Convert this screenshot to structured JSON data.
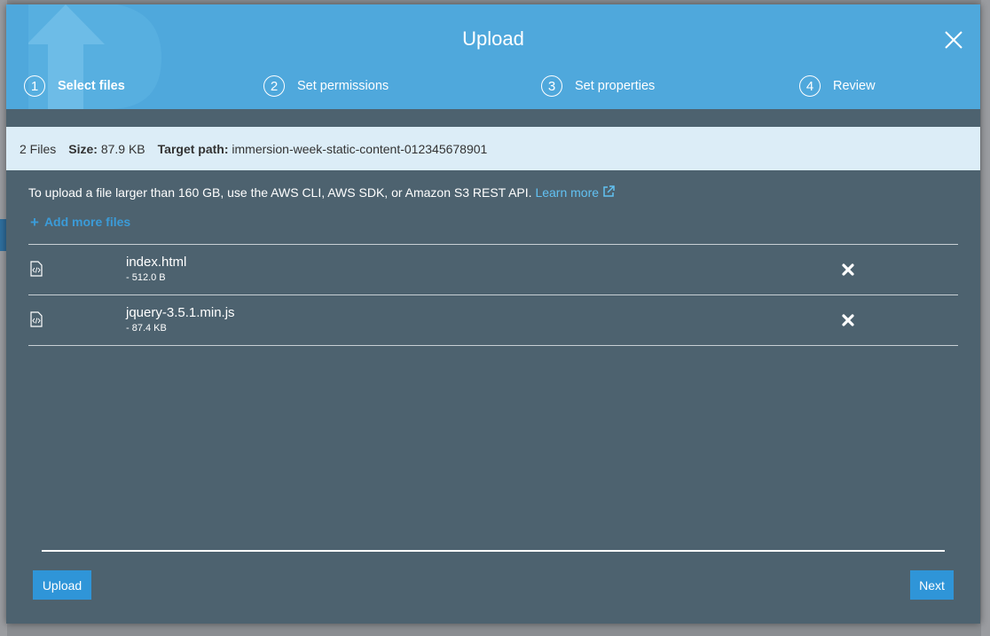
{
  "modal": {
    "title": "Upload"
  },
  "steps": [
    {
      "number": "1",
      "label": "Select files",
      "active": true
    },
    {
      "number": "2",
      "label": "Set permissions",
      "active": false
    },
    {
      "number": "3",
      "label": "Set properties",
      "active": false
    },
    {
      "number": "4",
      "label": "Review",
      "active": false
    }
  ],
  "summary": {
    "files_count": "2 Files",
    "size_label": "Size:",
    "size_value": "87.9 KB",
    "target_label": "Target path:",
    "target_value": "immersion-week-static-content-012345678901"
  },
  "info": {
    "text": "To upload a file larger than 160 GB, use the AWS CLI, AWS SDK, or Amazon S3 REST API.",
    "learn_more": "Learn more"
  },
  "add_more_label": "Add more files",
  "files": [
    {
      "name": "index.html",
      "size": "- 512.0 B"
    },
    {
      "name": "jquery-3.5.1.min.js",
      "size": "- 87.4 KB"
    }
  ],
  "footer": {
    "upload_label": "Upload",
    "next_label": "Next"
  },
  "colors": {
    "header": "#4fa8dc",
    "body": "#4d626f",
    "summary_bar": "#dcedf7",
    "button": "#2f95d8",
    "link": "#62c1f2"
  },
  "icons": {
    "close": "close-icon",
    "file": "code-file-icon",
    "remove": "remove-icon",
    "add": "plus-icon",
    "external": "external-link-icon"
  }
}
